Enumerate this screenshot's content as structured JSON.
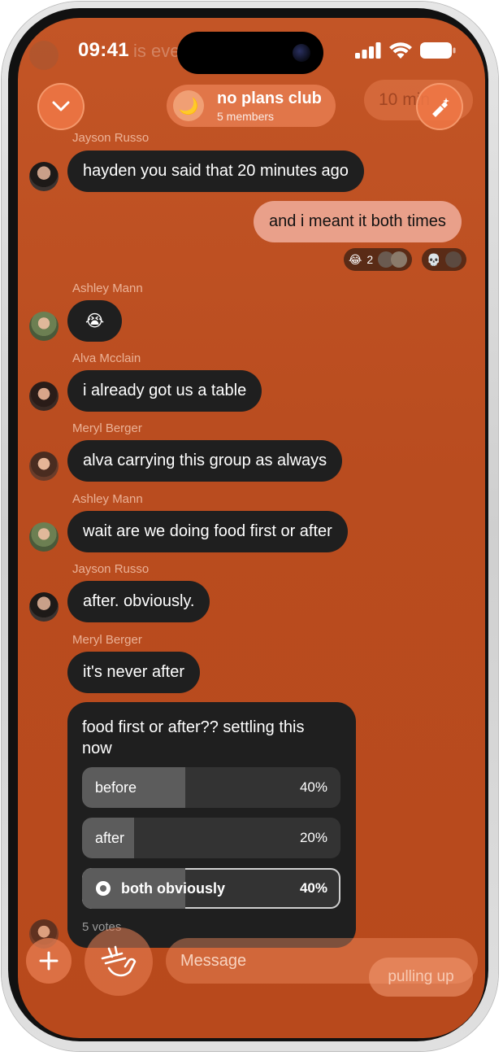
{
  "status": {
    "time": "09:41",
    "ghost": "is eve"
  },
  "header": {
    "group_name": "no plans club",
    "members": "5 members",
    "ghost_time": "10 min",
    "moon_icon": "moon-icon",
    "back_icon": "chevron-down-icon",
    "pin_icon": "sparkle-pen-icon"
  },
  "messages": [
    {
      "sender": "Jayson Russo",
      "text": "hayden you said that 20 minutes ago"
    },
    {
      "text": "and i meant it both times",
      "outgoing": true
    },
    {
      "sender": "Ashley Mann",
      "text": "😭"
    },
    {
      "sender": "Alva Mcclain",
      "text": "i already got us a table"
    },
    {
      "sender": "Meryl Berger",
      "text": "alva carrying this group as always"
    },
    {
      "sender": "Ashley Mann",
      "text": "wait are we doing food first or after"
    },
    {
      "sender": "Jayson Russo",
      "text": "after. obviously."
    },
    {
      "sender": "Meryl Berger",
      "text": "it's never after"
    }
  ],
  "reactions": [
    {
      "emoji": "😂",
      "count": "2"
    },
    {
      "emoji": "💀",
      "count": ""
    }
  ],
  "poll": {
    "question": "food first or after?? settling this now",
    "options": [
      {
        "label": "before",
        "percent": "40%",
        "fraction": 0.4
      },
      {
        "label": "after",
        "percent": "20%",
        "fraction": 0.2
      },
      {
        "label": "both obviously",
        "percent": "40%",
        "fraction": 0.4,
        "selected": true
      }
    ],
    "votes": "5 votes"
  },
  "composer": {
    "placeholder": "Message",
    "pulling_up": "pulling up"
  },
  "colors": {
    "background": "#b94c1f",
    "bubble": "#1f1f1f",
    "outgoing": "#e9a08a"
  }
}
